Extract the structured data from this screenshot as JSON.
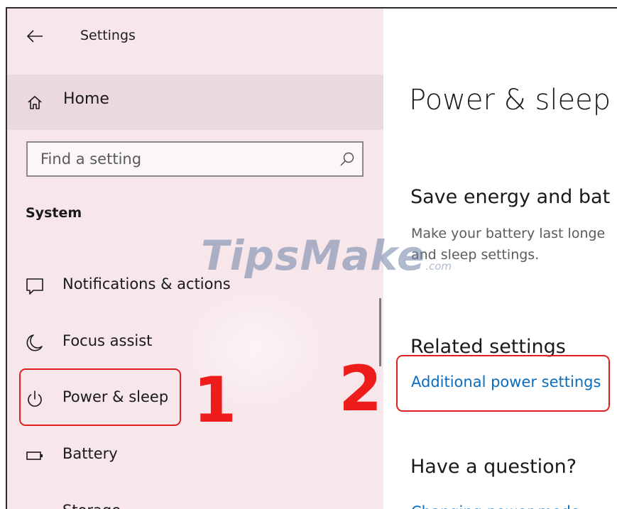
{
  "window": {
    "title": "Settings",
    "back_icon": "arrow-left-icon"
  },
  "sidebar": {
    "home": {
      "label": "Home",
      "icon": "home-icon"
    },
    "search": {
      "placeholder": "Find a setting",
      "value": "",
      "icon": "search-icon"
    },
    "section_header": "System",
    "items": [
      {
        "label": "Notifications & actions",
        "icon": "message-icon"
      },
      {
        "label": "Focus assist",
        "icon": "moon-icon"
      },
      {
        "label": "Power & sleep",
        "icon": "power-icon",
        "selected": true
      },
      {
        "label": "Battery",
        "icon": "battery-icon"
      },
      {
        "label": "Storage",
        "icon": "storage-icon"
      }
    ]
  },
  "main": {
    "page_title": "Power & sleep",
    "save_energy_heading": "Save energy and bat",
    "save_energy_desc_line1": "Make your battery last longe",
    "save_energy_desc_line2": "and sleep settings.",
    "related_heading": "Related settings",
    "related_link": "Additional power settings",
    "question_heading": "Have a question?",
    "question_link": "Changing power mode"
  },
  "annotations": {
    "callout_1": "1",
    "callout_2": "2",
    "callout_color": "#e02020"
  },
  "watermark": {
    "text": "TipsMake",
    "suffix": ".com"
  },
  "colors": {
    "sidebar_bg": "#f7e6ea",
    "home_row_bg": "#ead9de",
    "link": "#0a6dbf"
  }
}
